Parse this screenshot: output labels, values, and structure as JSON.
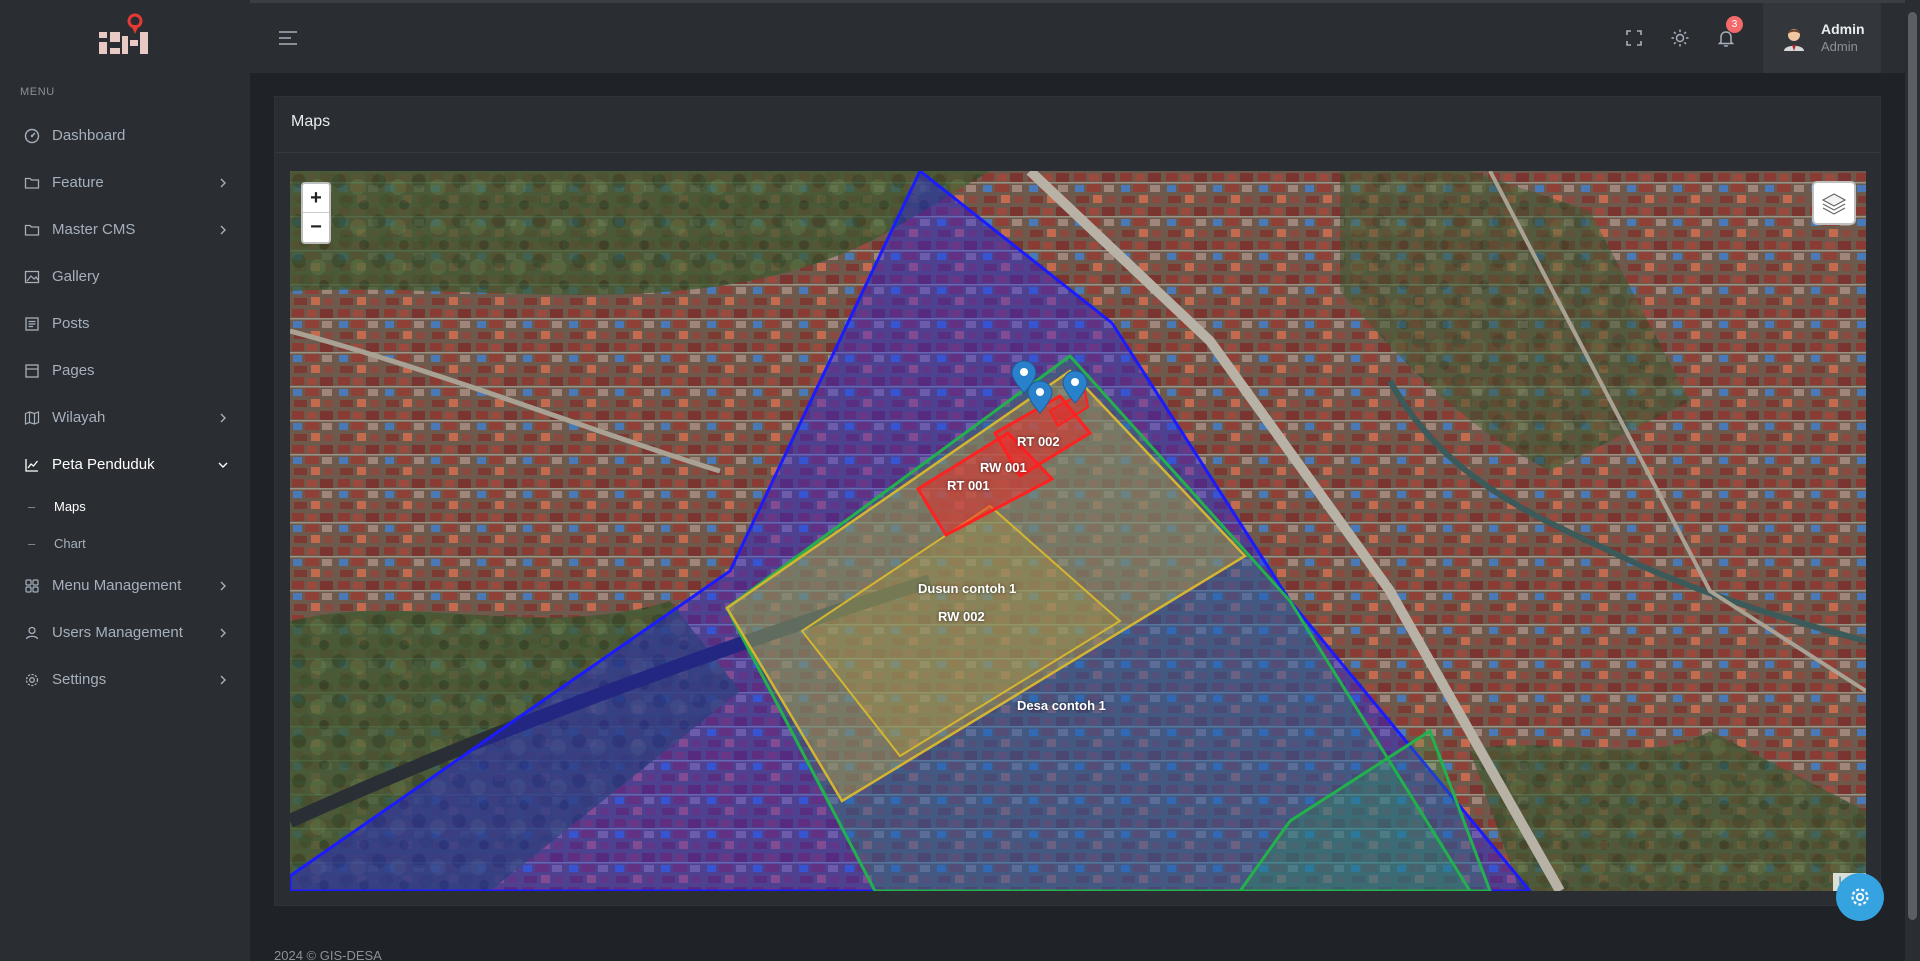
{
  "sidebar": {
    "menu_title": "MENU",
    "items": [
      {
        "label": "Dashboard",
        "icon": "dashboard-icon"
      },
      {
        "label": "Feature",
        "icon": "folder-icon"
      },
      {
        "label": "Master CMS",
        "icon": "folder-icon"
      },
      {
        "label": "Gallery",
        "icon": "gallery-icon"
      },
      {
        "label": "Posts",
        "icon": "posts-icon"
      },
      {
        "label": "Pages",
        "icon": "pages-icon"
      },
      {
        "label": "Wilayah",
        "icon": "map-icon"
      },
      {
        "label": "Peta Penduduk",
        "icon": "chart-line-icon"
      },
      {
        "label": "Menu Management",
        "icon": "grid-icon"
      },
      {
        "label": "Users Management",
        "icon": "user-icon"
      },
      {
        "label": "Settings",
        "icon": "gear-icon"
      }
    ],
    "sub_items": [
      {
        "label": "Maps"
      },
      {
        "label": "Chart"
      }
    ]
  },
  "header": {
    "notification_count": "3",
    "user_name": "Admin",
    "user_role": "Admin"
  },
  "page": {
    "title": "Maps"
  },
  "map": {
    "zoom_in": "+",
    "zoom_out": "−",
    "attribution": "Leaf",
    "labels": {
      "rt002": "RT 002",
      "rw001": "RW 001",
      "rt001": "RT 001",
      "dusun": "Dusun contoh 1",
      "rw002": "RW 002",
      "desa": "Desa contoh 1"
    },
    "colors": {
      "desa": "#1b1bff",
      "dusun": "#22b14c",
      "rw": "#d4b531",
      "rt": "#ff2020",
      "marker": "#2a81cb"
    }
  },
  "footer": {
    "text": "2024 © GIS-DESA"
  }
}
